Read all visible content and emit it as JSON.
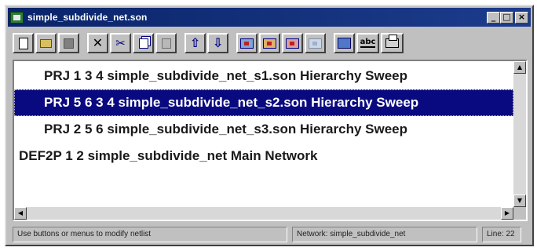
{
  "window": {
    "title": "simple_subdivide_net.son",
    "minimize_glyph": "_",
    "maximize_glyph": "□",
    "close_glyph": "×"
  },
  "toolbar": {
    "buttons": [
      {
        "name": "new-document",
        "icon": "new-document-icon"
      },
      {
        "name": "open",
        "icon": "open-folder-icon"
      },
      {
        "name": "save",
        "icon": "save-icon"
      },
      {
        "name": "delete",
        "icon": "delete-x-icon",
        "glyph": "✕"
      },
      {
        "name": "cut",
        "icon": "scissors-icon",
        "glyph": "✂"
      },
      {
        "name": "copy",
        "icon": "copy-icon"
      },
      {
        "name": "paste",
        "icon": "paste-icon"
      },
      {
        "name": "move-up",
        "icon": "arrow-up-icon",
        "glyph": "⇧"
      },
      {
        "name": "move-down",
        "icon": "arrow-down-icon",
        "glyph": "⇩"
      },
      {
        "name": "add-network",
        "icon": "network-icon"
      },
      {
        "name": "add-project",
        "icon": "project-orange-icon"
      },
      {
        "name": "add-project-red",
        "icon": "project-red-icon"
      },
      {
        "name": "disabled-item",
        "icon": "project-disabled-icon"
      },
      {
        "name": "sweep",
        "icon": "sweep-icon"
      },
      {
        "name": "text-edit",
        "icon": "abc-text-icon",
        "glyph": "abc"
      },
      {
        "name": "print",
        "icon": "printer-icon"
      }
    ]
  },
  "netlist": {
    "rows": [
      {
        "text": "PRJ 1 3 4 simple_subdivide_net_s1.son Hierarchy Sweep",
        "indent": true,
        "selected": false
      },
      {
        "text": "PRJ 5 6 3 4 simple_subdivide_net_s2.son Hierarchy Sweep",
        "indent": true,
        "selected": true
      },
      {
        "text": "PRJ 2 5 6 simple_subdivide_net_s3.son Hierarchy Sweep",
        "indent": true,
        "selected": false
      },
      {
        "text": "DEF2P 1 2 simple_subdivide_net Main Network",
        "indent": false,
        "selected": false
      }
    ]
  },
  "statusbar": {
    "message": "Use buttons or menus to modify netlist",
    "network": "Network: simple_subdivide_net",
    "line": "Line: 22"
  },
  "colors": {
    "title_bar": "#0a246a",
    "selection": "#0a0a80",
    "face": "#c0c0c0"
  }
}
